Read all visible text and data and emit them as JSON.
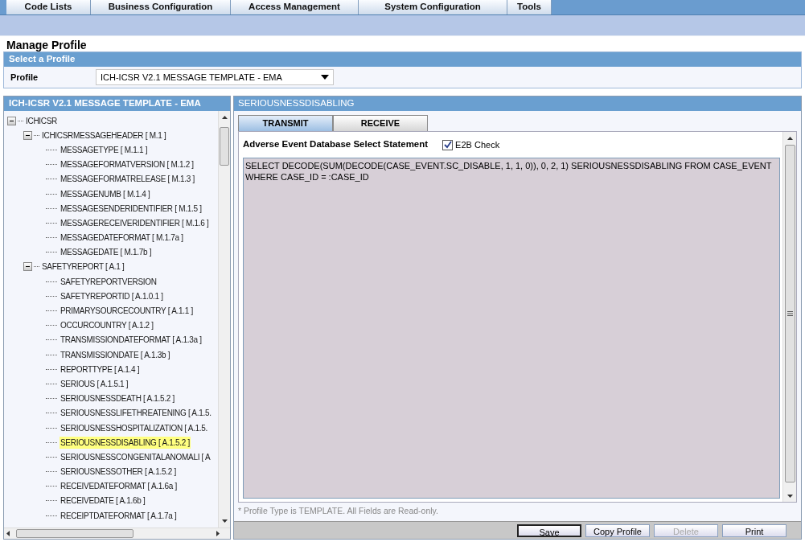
{
  "menu": [
    {
      "label": "Code Lists"
    },
    {
      "label": "Business Configuration"
    },
    {
      "label": "Access Management"
    },
    {
      "label": "System Configuration"
    },
    {
      "label": "Tools"
    }
  ],
  "page_title": "Manage Profile",
  "select_section": {
    "title": "Select a Profile",
    "label": "Profile",
    "value": "ICH-ICSR V2.1 MESSAGE TEMPLATE - EMA"
  },
  "tree_panel": {
    "title": "ICH-ICSR V2.1 MESSAGE TEMPLATE - EMA",
    "tree": [
      {
        "label": "ICHICSR",
        "expanded": true,
        "children": [
          {
            "label": "ICHICSRMESSAGEHEADER [ M.1 ]",
            "expanded": true,
            "children": [
              {
                "label": "MESSAGETYPE [ M.1.1 ]",
                "selected": false
              },
              {
                "label": "MESSAGEFORMATVERSION [ M.1.2 ]",
                "selected": false
              },
              {
                "label": "MESSAGEFORMATRELEASE [ M.1.3 ]",
                "selected": false
              },
              {
                "label": "MESSAGENUMB [ M.1.4 ]",
                "selected": false
              },
              {
                "label": "MESSAGESENDERIDENTIFIER [ M.1.5 ]",
                "selected": false
              },
              {
                "label": "MESSAGERECEIVERIDENTIFIER [ M.1.6 ]",
                "selected": false
              },
              {
                "label": "MESSAGEDATEFORMAT [ M.1.7a ]",
                "selected": false
              },
              {
                "label": "MESSAGEDATE [ M.1.7b ]",
                "selected": false
              }
            ]
          },
          {
            "label": "SAFETYREPORT [ A.1 ]",
            "expanded": true,
            "children": [
              {
                "label": "SAFETYREPORTVERSION",
                "selected": false
              },
              {
                "label": "SAFETYREPORTID [ A.1.0.1 ]",
                "selected": false
              },
              {
                "label": "PRIMARYSOURCECOUNTRY [ A.1.1 ]",
                "selected": false
              },
              {
                "label": "OCCURCOUNTRY [ A.1.2 ]",
                "selected": false
              },
              {
                "label": "TRANSMISSIONDATEFORMAT [ A.1.3a ]",
                "selected": false
              },
              {
                "label": "TRANSMISSIONDATE [ A.1.3b ]",
                "selected": false
              },
              {
                "label": "REPORTTYPE [ A.1.4 ]",
                "selected": false
              },
              {
                "label": "SERIOUS [ A.1.5.1 ]",
                "selected": false
              },
              {
                "label": "SERIOUSNESSDEATH [ A.1.5.2 ]",
                "selected": false
              },
              {
                "label": "SERIOUSNESSLIFETHREATENING [ A.1.5.",
                "selected": false
              },
              {
                "label": "SERIOUSNESSHOSPITALIZATION [ A.1.5.",
                "selected": false
              },
              {
                "label": "SERIOUSNESSDISABLING [ A.1.5.2 ]",
                "selected": true
              },
              {
                "label": "SERIOUSNESSCONGENITALANOMALI [ A",
                "selected": false
              },
              {
                "label": "SERIOUSNESSOTHER [ A.1.5.2 ]",
                "selected": false
              },
              {
                "label": "RECEIVEDATEFORMAT [ A.1.6a ]",
                "selected": false
              },
              {
                "label": "RECEIVEDATE [ A.1.6b ]",
                "selected": false
              },
              {
                "label": "RECEIPTDATEFORMAT [ A.1.7a ]",
                "selected": false
              }
            ]
          }
        ]
      }
    ]
  },
  "detail_panel": {
    "title": "SERIOUSNESSDISABLING",
    "tabs": [
      {
        "label": "TRANSMIT",
        "selected": true
      },
      {
        "label": "RECEIVE",
        "selected": false
      }
    ],
    "statement_label": "Adverse Event Database Select Statement",
    "e2b_check": {
      "label": "E2B Check",
      "checked": true
    },
    "statement": "SELECT DECODE(SUM(DECODE(CASE_EVENT.SC_DISABLE, 1, 1, 0)), 0, 2, 1) SERIOUSNESSDISABLING FROM CASE_EVENT WHERE CASE_ID = :CASE_ID",
    "note": "* Profile Type is TEMPLATE. All Fields are Read-only.",
    "buttons": [
      {
        "label": "Save",
        "disabled": false
      },
      {
        "label": "Copy Profile",
        "disabled": false
      },
      {
        "label": "Delete",
        "disabled": true
      },
      {
        "label": "Print",
        "disabled": false
      }
    ]
  }
}
